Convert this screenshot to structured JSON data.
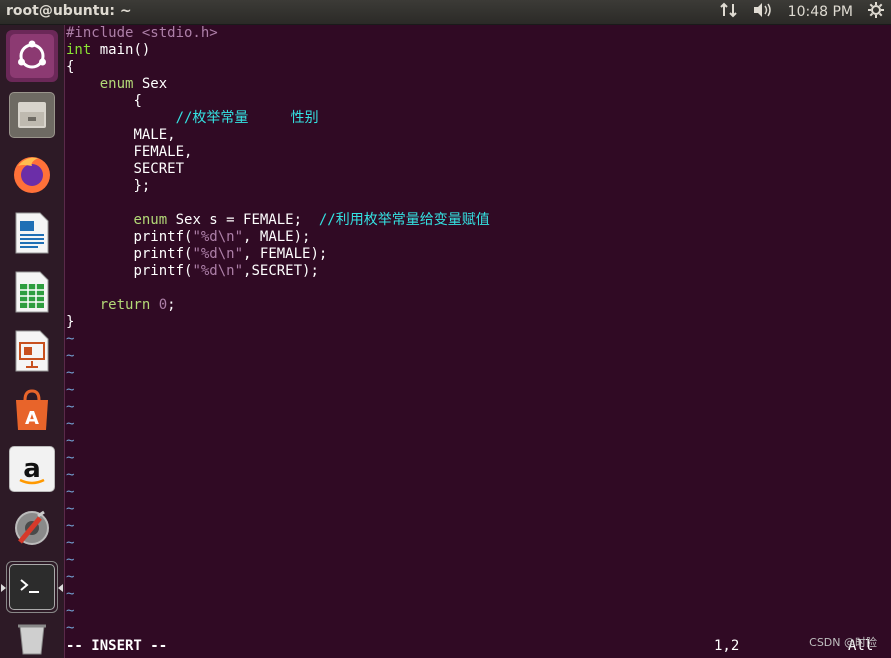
{
  "topbar": {
    "title": "root@ubuntu: ~",
    "clock": "10:48 PM"
  },
  "launcher": {
    "items": [
      {
        "icon": "ubuntu-logo-icon"
      },
      {
        "icon": "files-icon"
      },
      {
        "icon": "firefox-icon"
      },
      {
        "icon": "libreoffice-writer-icon"
      },
      {
        "icon": "libreoffice-calc-icon"
      },
      {
        "icon": "libreoffice-impress-icon"
      },
      {
        "icon": "software-center-icon"
      },
      {
        "icon": "amazon-icon"
      },
      {
        "icon": "system-settings-icon"
      },
      {
        "icon": "terminal-icon"
      },
      {
        "icon": "trash-icon"
      }
    ]
  },
  "code": {
    "l1": {
      "a": "#include ",
      "b": "<stdio.h>"
    },
    "l2": {
      "a": "int",
      "b": " main()"
    },
    "l3": "{",
    "l4": {
      "a": "enum",
      "b": " Sex"
    },
    "l5": "{",
    "l6": "//枚举常量     性别",
    "l7": "MALE,",
    "l8": "FEMALE,",
    "l9": "SECRET",
    "l10": "};",
    "l12": {
      "a": "enum",
      "b": " Sex s = FEMALE;  ",
      "c": "//利用枚举常量给变量赋值"
    },
    "l13": {
      "a": "printf(",
      "b": "\"%d\\n\"",
      "c": ", MALE);"
    },
    "l14": {
      "a": "printf(",
      "b": "\"%d\\n\"",
      "c": ", FEMALE);"
    },
    "l15": {
      "a": "printf(",
      "b": "\"%d\\n\"",
      "c": ",SECRET);"
    },
    "l17": {
      "a": "return",
      "b": " ",
      "c": "0",
      "d": ";"
    },
    "l18": "}",
    "tilde": "~"
  },
  "status": {
    "mode": "-- INSERT --",
    "position": "1,2",
    "scroll": "All"
  },
  "watermark": "CSDN @时险"
}
